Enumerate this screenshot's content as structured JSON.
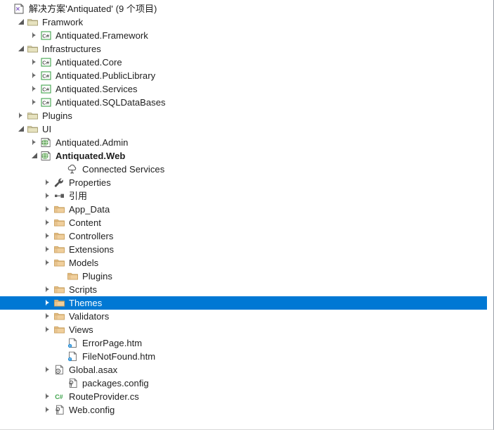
{
  "window": {
    "title": "Solution Explorer",
    "selection_color": "#0078d4",
    "background_color": "#ffffff",
    "text_color": "#1e1e1e"
  },
  "tree": {
    "root_label": "解决方案'Antiquated' (9 个项目)",
    "nodes": [
      {
        "label": "解决方案'Antiquated' (9 个项目)",
        "depth": 0,
        "icon": "solution-icon",
        "state": "none",
        "bold": false,
        "selected": false
      },
      {
        "label": "Framwork",
        "depth": 1,
        "icon": "solution-folder-icon",
        "state": "expanded",
        "bold": false,
        "selected": false
      },
      {
        "label": "Antiquated.Framework",
        "depth": 2,
        "icon": "csharp-project-icon",
        "state": "collapsed",
        "bold": false,
        "selected": false
      },
      {
        "label": "Infrastructures",
        "depth": 1,
        "icon": "solution-folder-icon",
        "state": "expanded",
        "bold": false,
        "selected": false
      },
      {
        "label": "Antiquated.Core",
        "depth": 2,
        "icon": "csharp-project-icon",
        "state": "collapsed",
        "bold": false,
        "selected": false
      },
      {
        "label": "Antiquated.PublicLibrary",
        "depth": 2,
        "icon": "csharp-project-icon",
        "state": "collapsed",
        "bold": false,
        "selected": false
      },
      {
        "label": "Antiquated.Services",
        "depth": 2,
        "icon": "csharp-project-icon",
        "state": "collapsed",
        "bold": false,
        "selected": false
      },
      {
        "label": "Antiquated.SQLDataBases",
        "depth": 2,
        "icon": "csharp-project-icon",
        "state": "collapsed",
        "bold": false,
        "selected": false
      },
      {
        "label": "Plugins",
        "depth": 1,
        "icon": "solution-folder-icon",
        "state": "collapsed",
        "bold": false,
        "selected": false
      },
      {
        "label": "UI",
        "depth": 1,
        "icon": "solution-folder-icon",
        "state": "expanded",
        "bold": false,
        "selected": false
      },
      {
        "label": "Antiquated.Admin",
        "depth": 2,
        "icon": "web-project-icon",
        "state": "collapsed",
        "bold": false,
        "selected": false
      },
      {
        "label": "Antiquated.Web",
        "depth": 2,
        "icon": "web-project-icon",
        "state": "expanded",
        "bold": true,
        "selected": false
      },
      {
        "label": "Connected Services",
        "depth": 4,
        "icon": "connected-services-icon",
        "state": "none",
        "bold": false,
        "selected": false
      },
      {
        "label": "Properties",
        "depth": 3,
        "icon": "wrench-icon",
        "state": "collapsed",
        "bold": false,
        "selected": false
      },
      {
        "label": "引用",
        "depth": 3,
        "icon": "references-icon",
        "state": "collapsed",
        "bold": false,
        "selected": false
      },
      {
        "label": "App_Data",
        "depth": 3,
        "icon": "folder-icon",
        "state": "collapsed",
        "bold": false,
        "selected": false
      },
      {
        "label": "Content",
        "depth": 3,
        "icon": "folder-icon",
        "state": "collapsed",
        "bold": false,
        "selected": false
      },
      {
        "label": "Controllers",
        "depth": 3,
        "icon": "folder-icon",
        "state": "collapsed",
        "bold": false,
        "selected": false
      },
      {
        "label": "Extensions",
        "depth": 3,
        "icon": "folder-icon",
        "state": "collapsed",
        "bold": false,
        "selected": false
      },
      {
        "label": "Models",
        "depth": 3,
        "icon": "folder-icon",
        "state": "collapsed",
        "bold": false,
        "selected": false
      },
      {
        "label": "Plugins",
        "depth": 4,
        "icon": "folder-icon",
        "state": "none",
        "bold": false,
        "selected": false
      },
      {
        "label": "Scripts",
        "depth": 3,
        "icon": "folder-icon",
        "state": "collapsed",
        "bold": false,
        "selected": false
      },
      {
        "label": "Themes",
        "depth": 3,
        "icon": "folder-icon",
        "state": "collapsed",
        "bold": false,
        "selected": true
      },
      {
        "label": "Validators",
        "depth": 3,
        "icon": "folder-icon",
        "state": "collapsed",
        "bold": false,
        "selected": false
      },
      {
        "label": "Views",
        "depth": 3,
        "icon": "folder-icon",
        "state": "collapsed",
        "bold": false,
        "selected": false
      },
      {
        "label": "ErrorPage.htm",
        "depth": 4,
        "icon": "html-file-icon",
        "state": "none",
        "bold": false,
        "selected": false
      },
      {
        "label": "FileNotFound.htm",
        "depth": 4,
        "icon": "html-file-icon",
        "state": "none",
        "bold": false,
        "selected": false
      },
      {
        "label": "Global.asax",
        "depth": 3,
        "icon": "asax-file-icon",
        "state": "collapsed",
        "bold": false,
        "selected": false
      },
      {
        "label": "packages.config",
        "depth": 4,
        "icon": "config-file-icon",
        "state": "none",
        "bold": false,
        "selected": false
      },
      {
        "label": "RouteProvider.cs",
        "depth": 3,
        "icon": "csharp-file-icon",
        "state": "collapsed",
        "bold": false,
        "selected": false
      },
      {
        "label": "Web.config",
        "depth": 3,
        "icon": "config-file-icon",
        "state": "collapsed",
        "bold": false,
        "selected": false
      }
    ]
  },
  "icon_colors": {
    "solution": "#8661c5",
    "solution_folder": "#c8b88a",
    "folder": "#dcb67a",
    "csharp": "#3fa34c",
    "web_project": "#4a9b3f",
    "file": "#6d6d6d",
    "html_accent": "#1e8ad6"
  }
}
